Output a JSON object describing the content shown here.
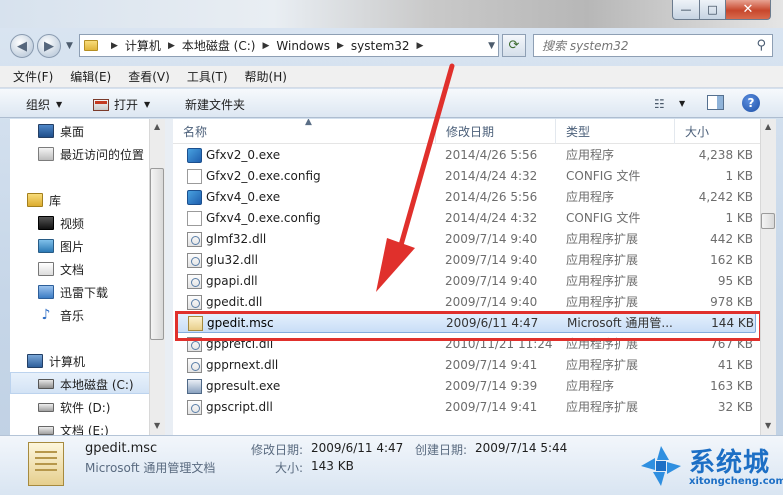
{
  "window": {
    "min_label": "—",
    "max_label": "□",
    "close_label": "✕"
  },
  "address": {
    "crumbs": [
      "计算机",
      "本地磁盘 (C:)",
      "Windows",
      "system32"
    ],
    "search_placeholder": "搜索 system32"
  },
  "menu": [
    "文件(F)",
    "编辑(E)",
    "查看(V)",
    "工具(T)",
    "帮助(H)"
  ],
  "toolbar": {
    "organize": "组织",
    "open": "打开",
    "new_folder": "新建文件夹",
    "help": "?"
  },
  "nav": {
    "items": [
      {
        "label": "桌面",
        "icon": "desktop-icon"
      },
      {
        "label": "最近访问的位置",
        "icon": "recent-places-icon"
      },
      {
        "label": "库",
        "icon": "library-icon"
      },
      {
        "label": "视频",
        "icon": "video-icon"
      },
      {
        "label": "图片",
        "icon": "picture-icon"
      },
      {
        "label": "文档",
        "icon": "document-icon"
      },
      {
        "label": "迅雷下载",
        "icon": "thunder-download-icon"
      },
      {
        "label": "音乐",
        "icon": "music-icon"
      },
      {
        "label": "计算机",
        "icon": "computer-icon"
      },
      {
        "label": "本地磁盘 (C:)",
        "icon": "local-disk-icon"
      },
      {
        "label": "软件 (D:)",
        "icon": "hard-disk-icon"
      },
      {
        "label": "文档 (E:)",
        "icon": "hard-disk-icon"
      }
    ]
  },
  "columns": {
    "name": "名称",
    "date": "修改日期",
    "type": "类型",
    "size": "大小"
  },
  "files": [
    {
      "name": "Gfxv2_0.exe",
      "date": "2014/4/26 5:56",
      "type": "应用程序",
      "size": "4,238 KB",
      "icon": "exe"
    },
    {
      "name": "Gfxv2_0.exe.config",
      "date": "2014/4/24 4:32",
      "type": "CONFIG 文件",
      "size": "1 KB",
      "icon": "config"
    },
    {
      "name": "Gfxv4_0.exe",
      "date": "2014/4/26 5:56",
      "type": "应用程序",
      "size": "4,242 KB",
      "icon": "exe"
    },
    {
      "name": "Gfxv4_0.exe.config",
      "date": "2014/4/24 4:32",
      "type": "CONFIG 文件",
      "size": "1 KB",
      "icon": "config"
    },
    {
      "name": "glmf32.dll",
      "date": "2009/7/14 9:40",
      "type": "应用程序扩展",
      "size": "442 KB",
      "icon": "dll"
    },
    {
      "name": "glu32.dll",
      "date": "2009/7/14 9:40",
      "type": "应用程序扩展",
      "size": "162 KB",
      "icon": "dll"
    },
    {
      "name": "gpapi.dll",
      "date": "2009/7/14 9:40",
      "type": "应用程序扩展",
      "size": "95 KB",
      "icon": "dll"
    },
    {
      "name": "gpedit.dll",
      "date": "2009/7/14 9:40",
      "type": "应用程序扩展",
      "size": "978 KB",
      "icon": "dll"
    },
    {
      "name": "gpedit.msc",
      "date": "2009/6/11 4:47",
      "type": "Microsoft 通用管...",
      "size": "144 KB",
      "icon": "msc",
      "selected": true
    },
    {
      "name": "gpprefcl.dll",
      "date": "2010/11/21 11:24",
      "type": "应用程序扩展",
      "size": "767 KB",
      "icon": "dll"
    },
    {
      "name": "gpprnext.dll",
      "date": "2009/7/14 9:41",
      "type": "应用程序扩展",
      "size": "41 KB",
      "icon": "dll"
    },
    {
      "name": "gpresult.exe",
      "date": "2009/7/14 9:39",
      "type": "应用程序",
      "size": "163 KB",
      "icon": "exe2"
    },
    {
      "name": "gpscript.dll",
      "date": "2009/7/14 9:41",
      "type": "应用程序扩展",
      "size": "32 KB",
      "icon": "dll"
    }
  ],
  "details": {
    "name": "gpedit.msc",
    "type": "Microsoft 通用管理文档",
    "modified_label": "修改日期:",
    "modified_value": "2009/6/11 4:47",
    "created_label": "创建日期:",
    "created_value": "2009/7/14 5:44",
    "size_label": "大小:",
    "size_value": "143 KB"
  },
  "watermark": {
    "text": "系统城",
    "url": "xitongcheng.com"
  },
  "colors": {
    "annotation_red": "#e0302c",
    "selection_blue": "#84acdd"
  }
}
